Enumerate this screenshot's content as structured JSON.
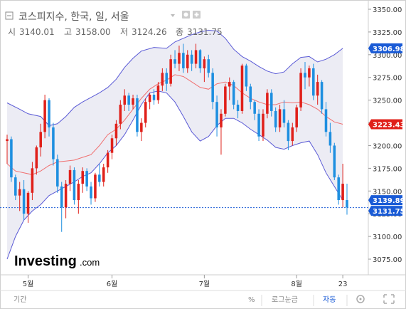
{
  "header": {
    "collapse_icon": "square-minus-icon",
    "title": "코스피지수, 한국, 일, 서울",
    "dropdown_icon": "caret-down-icon",
    "settings_icon": "gear-icon",
    "add_icon": "plus-box-icon",
    "ohlc": {
      "open_label": "시",
      "open": "3140.01",
      "high_label": "고",
      "high": "3158.00",
      "low_label": "저",
      "low": "3124.26",
      "close_label": "종",
      "close": "3131.75"
    }
  },
  "badges": [
    {
      "text": "3306.98",
      "value": 3306.98,
      "color": "#1a5bd6"
    },
    {
      "text": "3223.43",
      "value": 3223.43,
      "color": "#e0201a"
    },
    {
      "text": "3139.89",
      "value": 3139.89,
      "color": "#1a5bd6"
    },
    {
      "text": "3131.75",
      "value": 3131.75,
      "color": "#1a5bd6"
    }
  ],
  "logo": {
    "main": "Investing",
    "sub": ".com"
  },
  "bottom_bar": {
    "period_label": "기간",
    "percent_label": "%",
    "log_label": "로그눈금",
    "auto_label": "자동",
    "settings_icon": "gear-icon",
    "fullscreen_icon": "expand-icon"
  },
  "colors": {
    "up": "#e0201a",
    "down": "#1e8fe0",
    "band": "#5a5ad6",
    "ma": "#f07070",
    "band_fill": "#ececf4",
    "dotted": "#1a5bd6"
  },
  "chart_data": {
    "type": "candlestick",
    "title": "코스피지수, 한국, 일, 서울",
    "y_ticks": [
      3075,
      3100,
      3125,
      3150,
      3175,
      3200,
      3225,
      3250,
      3275,
      3300,
      3325,
      3350
    ],
    "y_tick_labels": [
      "3075.00",
      "3100.00",
      "3125.00",
      "3150.00",
      "3175.00",
      "3200.00",
      "3225.00",
      "3250.00",
      "3275.00",
      "3300.00",
      "3325.00",
      "3350.00"
    ],
    "ylim": [
      3060,
      3355
    ],
    "x_labels": [
      {
        "label": "5월",
        "index": 5
      },
      {
        "label": "6월",
        "index": 25
      },
      {
        "label": "7월",
        "index": 47
      },
      {
        "label": "8월",
        "index": 69
      },
      {
        "label": "23",
        "index": 80
      }
    ],
    "ohlc": [
      [
        3205,
        3212,
        3180,
        3207
      ],
      [
        3207,
        3210,
        3160,
        3165
      ],
      [
        3165,
        3168,
        3140,
        3145
      ],
      [
        3145,
        3160,
        3128,
        3152
      ],
      [
        3152,
        3162,
        3118,
        3125
      ],
      [
        3125,
        3150,
        3115,
        3148
      ],
      [
        3148,
        3182,
        3140,
        3175
      ],
      [
        3175,
        3200,
        3168,
        3198
      ],
      [
        3198,
        3224,
        3188,
        3215
      ],
      [
        3215,
        3256,
        3208,
        3250
      ],
      [
        3250,
        3252,
        3210,
        3220
      ],
      [
        3220,
        3225,
        3178,
        3185
      ],
      [
        3185,
        3190,
        3148,
        3155
      ],
      [
        3155,
        3160,
        3105,
        3132
      ],
      [
        3132,
        3162,
        3120,
        3158
      ],
      [
        3158,
        3178,
        3150,
        3173
      ],
      [
        3173,
        3176,
        3135,
        3140
      ],
      [
        3140,
        3162,
        3125,
        3158
      ],
      [
        3158,
        3176,
        3148,
        3172
      ],
      [
        3172,
        3175,
        3150,
        3155
      ],
      [
        3155,
        3160,
        3135,
        3142
      ],
      [
        3142,
        3170,
        3138,
        3168
      ],
      [
        3168,
        3180,
        3155,
        3160
      ],
      [
        3160,
        3180,
        3155,
        3176
      ],
      [
        3176,
        3195,
        3170,
        3192
      ],
      [
        3192,
        3212,
        3185,
        3208
      ],
      [
        3208,
        3228,
        3200,
        3224
      ],
      [
        3224,
        3250,
        3218,
        3245
      ],
      [
        3245,
        3262,
        3238,
        3255
      ],
      [
        3255,
        3258,
        3238,
        3245
      ],
      [
        3245,
        3256,
        3240,
        3252
      ],
      [
        3252,
        3256,
        3210,
        3215
      ],
      [
        3215,
        3230,
        3205,
        3225
      ],
      [
        3225,
        3252,
        3220,
        3248
      ],
      [
        3248,
        3258,
        3240,
        3256
      ],
      [
        3256,
        3262,
        3245,
        3250
      ],
      [
        3250,
        3270,
        3246,
        3266
      ],
      [
        3266,
        3285,
        3260,
        3280
      ],
      [
        3280,
        3285,
        3260,
        3268
      ],
      [
        3268,
        3300,
        3265,
        3295
      ],
      [
        3295,
        3305,
        3285,
        3290
      ],
      [
        3290,
        3310,
        3282,
        3302
      ],
      [
        3302,
        3312,
        3280,
        3285
      ],
      [
        3285,
        3305,
        3280,
        3300
      ],
      [
        3300,
        3305,
        3282,
        3290
      ],
      [
        3290,
        3312,
        3285,
        3305
      ],
      [
        3305,
        3306,
        3280,
        3285
      ],
      [
        3285,
        3298,
        3270,
        3295
      ],
      [
        3295,
        3300,
        3275,
        3280
      ],
      [
        3280,
        3285,
        3240,
        3248
      ],
      [
        3248,
        3255,
        3210,
        3220
      ],
      [
        3220,
        3240,
        3190,
        3235
      ],
      [
        3235,
        3268,
        3232,
        3265
      ],
      [
        3265,
        3275,
        3250,
        3270
      ],
      [
        3270,
        3272,
        3240,
        3245
      ],
      [
        3245,
        3250,
        3230,
        3238
      ],
      [
        3238,
        3290,
        3235,
        3288
      ],
      [
        3288,
        3290,
        3260,
        3265
      ],
      [
        3265,
        3268,
        3240,
        3248
      ],
      [
        3248,
        3250,
        3228,
        3235
      ],
      [
        3235,
        3240,
        3205,
        3210
      ],
      [
        3210,
        3240,
        3205,
        3235
      ],
      [
        3235,
        3262,
        3230,
        3258
      ],
      [
        3258,
        3262,
        3232,
        3238
      ],
      [
        3238,
        3242,
        3215,
        3220
      ],
      [
        3220,
        3245,
        3215,
        3240
      ],
      [
        3240,
        3250,
        3220,
        3225
      ],
      [
        3225,
        3228,
        3195,
        3205
      ],
      [
        3205,
        3225,
        3200,
        3220
      ],
      [
        3220,
        3245,
        3215,
        3242
      ],
      [
        3242,
        3285,
        3238,
        3280
      ],
      [
        3280,
        3292,
        3262,
        3275
      ],
      [
        3275,
        3288,
        3265,
        3285
      ],
      [
        3285,
        3290,
        3250,
        3255
      ],
      [
        3255,
        3278,
        3245,
        3270
      ],
      [
        3270,
        3272,
        3235,
        3240
      ],
      [
        3240,
        3248,
        3210,
        3215
      ],
      [
        3215,
        3225,
        3192,
        3200
      ],
      [
        3200,
        3203,
        3162,
        3165
      ],
      [
        3165,
        3168,
        3135,
        3140
      ],
      [
        3140,
        3180,
        3132,
        3158
      ],
      [
        3140,
        3158,
        3124,
        3132
      ]
    ],
    "bollinger_upper": [
      [
        0,
        3247
      ],
      [
        3,
        3240
      ],
      [
        5,
        3235
      ],
      [
        8,
        3232
      ],
      [
        10,
        3222
      ],
      [
        12,
        3224
      ],
      [
        14,
        3232
      ],
      [
        16,
        3242
      ],
      [
        18,
        3248
      ],
      [
        20,
        3253
      ],
      [
        22,
        3258
      ],
      [
        24,
        3264
      ],
      [
        26,
        3273
      ],
      [
        28,
        3286
      ],
      [
        30,
        3296
      ],
      [
        32,
        3304
      ],
      [
        35,
        3308
      ],
      [
        38,
        3307
      ],
      [
        40,
        3314
      ],
      [
        42,
        3318
      ],
      [
        44,
        3322
      ],
      [
        46,
        3325
      ],
      [
        48,
        3327
      ],
      [
        50,
        3326
      ],
      [
        52,
        3318
      ],
      [
        54,
        3306
      ],
      [
        56,
        3298
      ],
      [
        58,
        3293
      ],
      [
        60,
        3287
      ],
      [
        62,
        3282
      ],
      [
        64,
        3279
      ],
      [
        66,
        3281
      ],
      [
        68,
        3290
      ],
      [
        70,
        3297
      ],
      [
        72,
        3298
      ],
      [
        74,
        3292
      ],
      [
        76,
        3295
      ],
      [
        78,
        3300
      ],
      [
        80,
        3306.98
      ]
    ],
    "bollinger_lower": [
      [
        0,
        3075
      ],
      [
        2,
        3100
      ],
      [
        4,
        3118
      ],
      [
        6,
        3128
      ],
      [
        8,
        3135
      ],
      [
        10,
        3145
      ],
      [
        12,
        3150
      ],
      [
        14,
        3155
      ],
      [
        16,
        3160
      ],
      [
        18,
        3166
      ],
      [
        20,
        3170
      ],
      [
        22,
        3180
      ],
      [
        24,
        3192
      ],
      [
        26,
        3200
      ],
      [
        28,
        3212
      ],
      [
        30,
        3228
      ],
      [
        32,
        3245
      ],
      [
        34,
        3258
      ],
      [
        36,
        3260
      ],
      [
        38,
        3258
      ],
      [
        40,
        3248
      ],
      [
        42,
        3232
      ],
      [
        44,
        3215
      ],
      [
        46,
        3205
      ],
      [
        48,
        3210
      ],
      [
        50,
        3222
      ],
      [
        52,
        3230
      ],
      [
        54,
        3230
      ],
      [
        56,
        3225
      ],
      [
        58,
        3218
      ],
      [
        60,
        3212
      ],
      [
        62,
        3206
      ],
      [
        64,
        3198
      ],
      [
        66,
        3196
      ],
      [
        68,
        3200
      ],
      [
        70,
        3203
      ],
      [
        72,
        3205
      ],
      [
        74,
        3190
      ],
      [
        76,
        3170
      ],
      [
        78,
        3155
      ],
      [
        80,
        3139.89
      ]
    ],
    "bollinger_mid": [
      [
        0,
        3180
      ],
      [
        2,
        3172
      ],
      [
        4,
        3170
      ],
      [
        6,
        3168
      ],
      [
        8,
        3172
      ],
      [
        10,
        3178
      ],
      [
        12,
        3182
      ],
      [
        14,
        3183
      ],
      [
        16,
        3184
      ],
      [
        18,
        3187
      ],
      [
        20,
        3190
      ],
      [
        22,
        3200
      ],
      [
        24,
        3212
      ],
      [
        26,
        3218
      ],
      [
        28,
        3228
      ],
      [
        30,
        3240
      ],
      [
        32,
        3252
      ],
      [
        34,
        3262
      ],
      [
        36,
        3268
      ],
      [
        38,
        3272
      ],
      [
        40,
        3278
      ],
      [
        42,
        3276
      ],
      [
        44,
        3270
      ],
      [
        46,
        3264
      ],
      [
        48,
        3262
      ],
      [
        50,
        3268
      ],
      [
        52,
        3270
      ],
      [
        54,
        3266
      ],
      [
        56,
        3258
      ],
      [
        58,
        3252
      ],
      [
        60,
        3248
      ],
      [
        62,
        3245
      ],
      [
        64,
        3245
      ],
      [
        66,
        3248
      ],
      [
        68,
        3247
      ],
      [
        70,
        3248
      ],
      [
        72,
        3245
      ],
      [
        74,
        3240
      ],
      [
        76,
        3232
      ],
      [
        78,
        3226
      ],
      [
        80,
        3223.43
      ]
    ],
    "last_close": 3131.75
  }
}
